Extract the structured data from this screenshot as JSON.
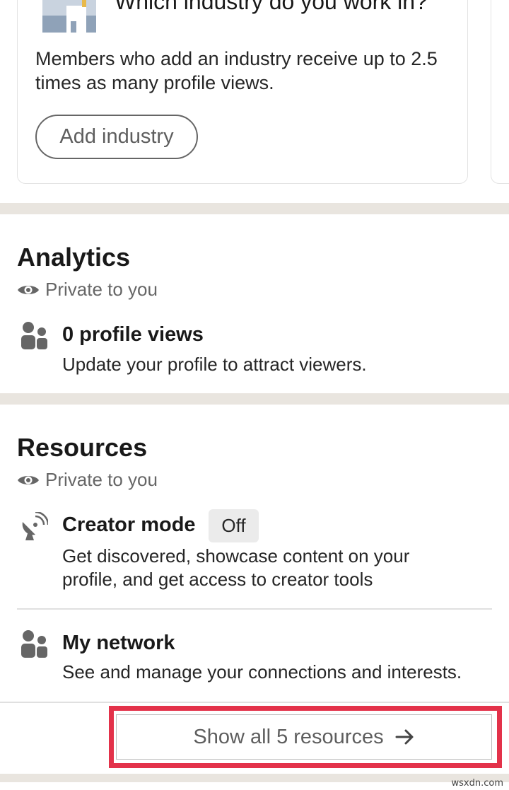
{
  "industry_card": {
    "title": "Which industry do you work in?",
    "description": "Members who add an industry receive up to 2.5 times as many profile views.",
    "button_label": "Add industry"
  },
  "analytics": {
    "title": "Analytics",
    "visibility": "Private to you",
    "profile_views": {
      "title": "0 profile views",
      "description": "Update your profile to attract viewers."
    }
  },
  "resources": {
    "title": "Resources",
    "visibility": "Private to you",
    "creator_mode": {
      "title": "Creator mode",
      "status": "Off",
      "description_line1": "Get discovered, showcase content on your",
      "description_line2": "profile, and get access to creator tools"
    },
    "my_network": {
      "title": "My network",
      "description": "See and manage your connections and interests."
    },
    "show_all_label": "Show all 5 resources"
  },
  "watermark": "wsxdn.com",
  "colors": {
    "highlight": "#e3324a",
    "divider": "#e9e5df",
    "text_primary": "#191919",
    "text_secondary": "#666666"
  }
}
